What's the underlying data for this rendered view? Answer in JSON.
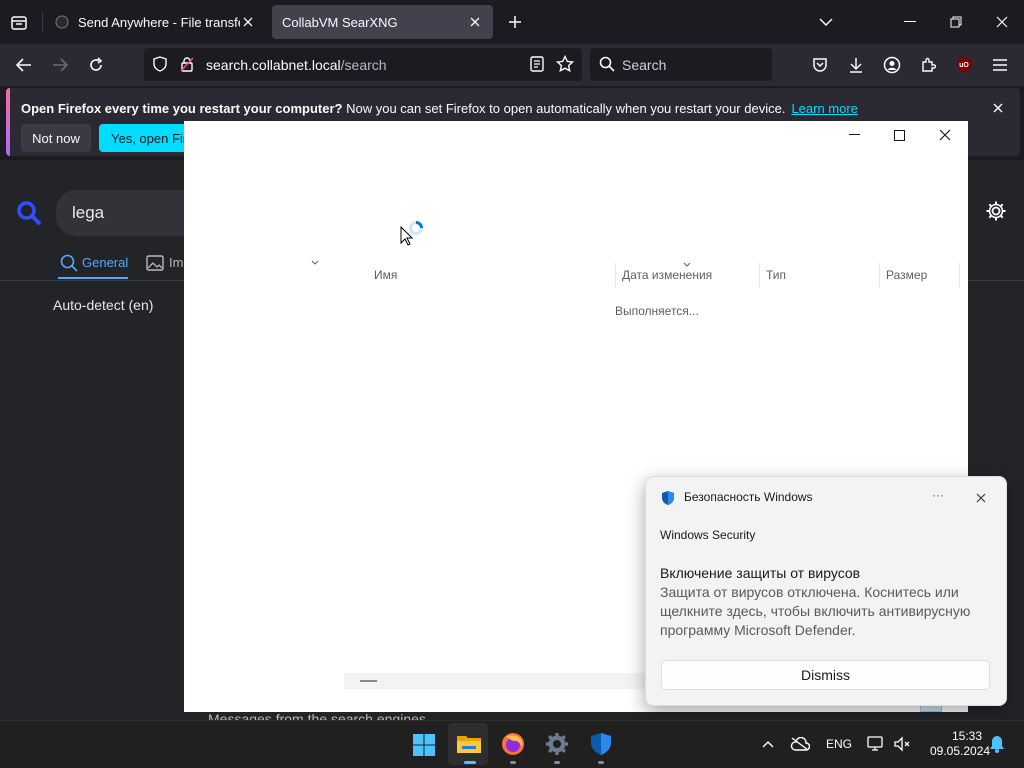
{
  "browser": {
    "tabs": [
      {
        "title": "Send Anywhere - File transfer",
        "active": false
      },
      {
        "title": "CollabVM SearXNG",
        "active": true
      }
    ],
    "url": {
      "host": "search.collabnet.local",
      "path": "/search"
    },
    "search_placeholder": "Search",
    "extension_badge": "uO"
  },
  "notification": {
    "bold": "Open Firefox every time you restart your computer?",
    "text": "Now you can set Firefox to open automatically when you restart your device.",
    "link": "Learn more",
    "not_now": "Not now",
    "yes": "Yes, open Firefox"
  },
  "searx": {
    "query": "lega",
    "tabs": {
      "general": "General",
      "images": "Images"
    },
    "language": "Auto-detect (en)",
    "messages": "Messages from the search engines"
  },
  "explorer": {
    "columns": [
      "Имя",
      "Дата изменения",
      "Тип",
      "Размер"
    ],
    "status": "Выполняется..."
  },
  "toast": {
    "app": "Безопасность Windows",
    "subtitle": "Windows Security",
    "title": "Включение защиты от вирусов",
    "body": "Защита от вирусов отключена. Коснитесь или щелкните здесь, чтобы включить антивирусную программу Microsoft Defender.",
    "dismiss": "Dismiss",
    "more": "···"
  },
  "taskbar": {
    "lang": "ENG",
    "time": "15:33",
    "date": "09.05.2024"
  },
  "colors": {
    "accent": "#00ddff",
    "searx_blue": "#58a6ff",
    "win_blue": "#0078d4"
  }
}
